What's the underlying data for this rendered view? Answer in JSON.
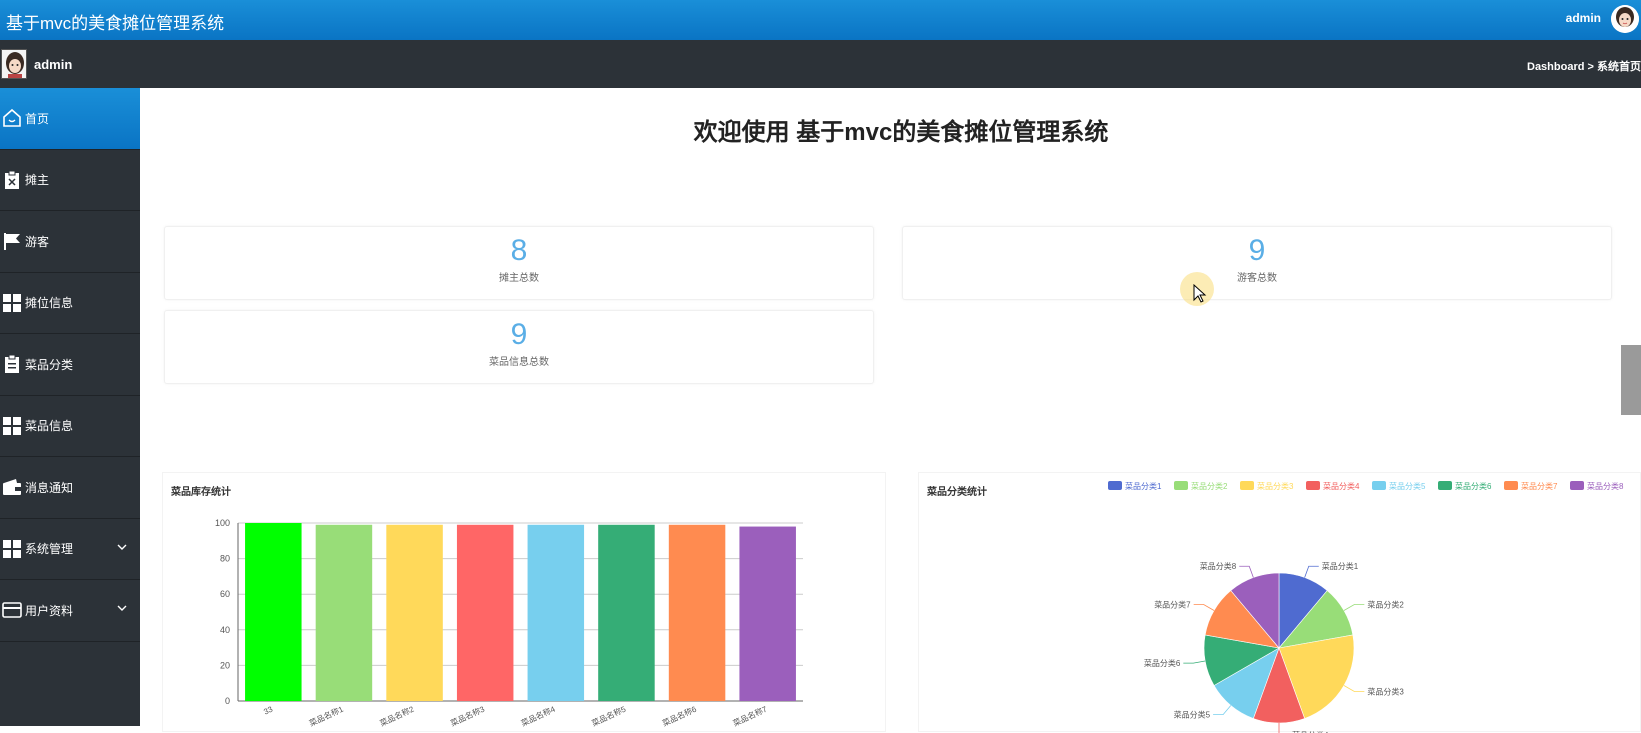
{
  "header": {
    "app_title": "基于mvc的美食摊位管理系统",
    "user": "admin"
  },
  "subheader": {
    "user": "admin",
    "breadcrumb": "Dashboard > 系统首页"
  },
  "sidebar": {
    "items": [
      {
        "label": "首页",
        "icon": "home-icon",
        "active": true
      },
      {
        "label": "摊主",
        "icon": "clipboard-x-icon"
      },
      {
        "label": "游客",
        "icon": "flag-icon"
      },
      {
        "label": "摊位信息",
        "icon": "grid-icon"
      },
      {
        "label": "菜品分类",
        "icon": "clipboard-icon"
      },
      {
        "label": "菜品信息",
        "icon": "grid-icon"
      },
      {
        "label": "消息通知",
        "icon": "wallet-icon"
      },
      {
        "label": "系统管理",
        "icon": "grid-icon",
        "expandable": true
      },
      {
        "label": "用户资料",
        "icon": "card-icon",
        "expandable": true
      }
    ]
  },
  "main": {
    "welcome": "欢迎使用 基于mvc的美食摊位管理系统",
    "stats": [
      {
        "value": "8",
        "label": "摊主总数"
      },
      {
        "value": "9",
        "label": "游客总数"
      },
      {
        "value": "9",
        "label": "菜品信息总数"
      }
    ]
  },
  "chart_data": [
    {
      "type": "bar",
      "title": "菜品库存统计",
      "categories": [
        "33",
        "菜品名称1",
        "菜品名称2",
        "菜品名称3",
        "菜品名称4",
        "菜品名称5",
        "菜品名称6",
        "菜品名称7"
      ],
      "values": [
        100,
        99,
        99,
        99,
        99,
        99,
        99,
        98
      ],
      "colors": [
        "#00ff00",
        "#98dd78",
        "#ffd95a",
        "#ff6666",
        "#77cfee",
        "#35ad76",
        "#ff8b50",
        "#9b5fbc"
      ],
      "ylim": [
        0,
        100
      ],
      "yticks": [
        0,
        20,
        40,
        60,
        80,
        100
      ],
      "grid": true
    },
    {
      "type": "pie",
      "title": "菜品分类统计",
      "legend_position": "top-right",
      "labels": [
        "菜品分类1",
        "菜品分类2",
        "菜品分类3",
        "菜品分类4",
        "菜品分类5",
        "菜品分类6",
        "菜品分类7",
        "菜品分类8"
      ],
      "legend_labels": [
        "菜品分类1",
        "菜品分类2",
        "菜品分类3",
        "菜品分类4",
        "菜品分类5",
        "菜品分类6",
        "菜品分类7",
        "菜品分类8"
      ],
      "values": [
        1,
        1,
        2,
        1,
        1,
        1,
        1,
        1
      ],
      "colors": [
        "#4f6bd0",
        "#98dd78",
        "#ffd95a",
        "#f2605f",
        "#77cfee",
        "#35ad76",
        "#ff8b50",
        "#9b5fbc"
      ]
    }
  ]
}
